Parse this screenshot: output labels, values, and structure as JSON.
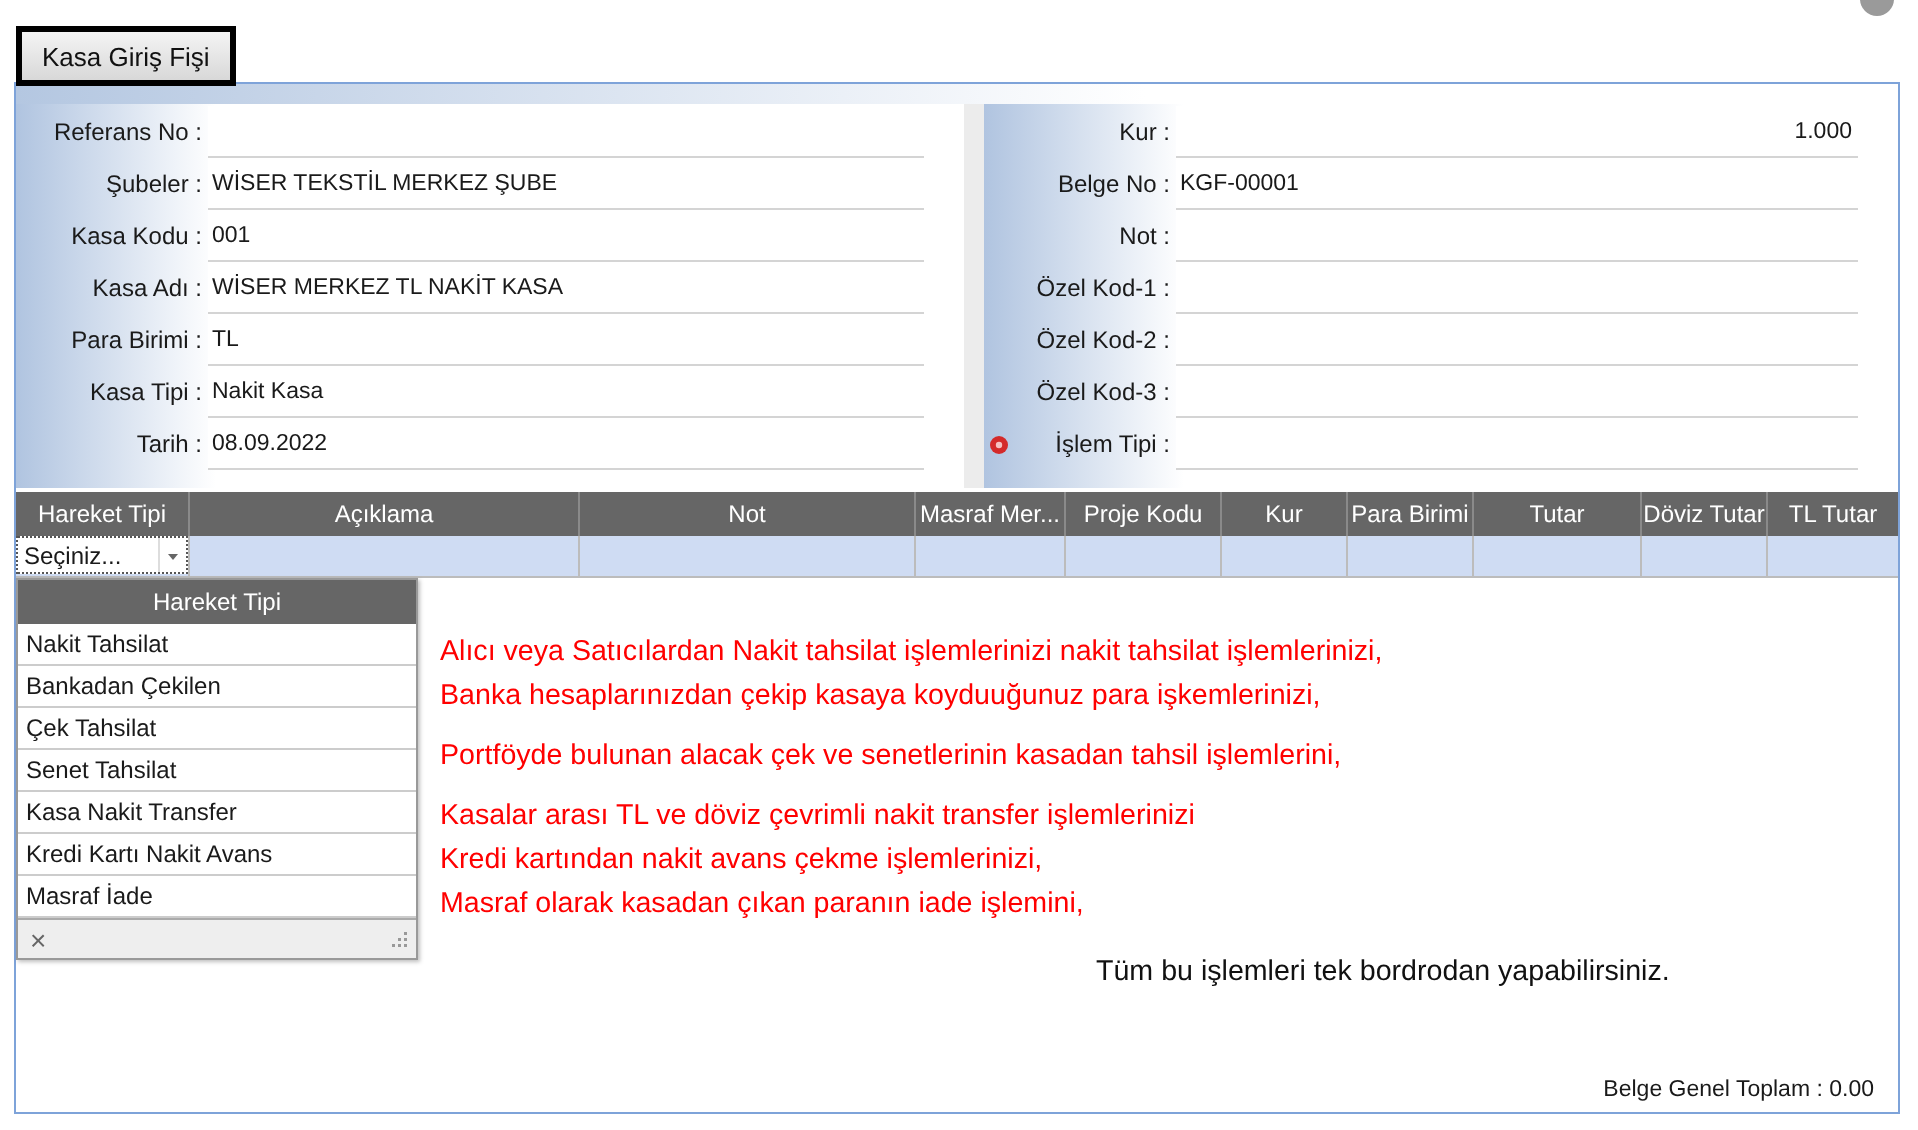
{
  "tab": {
    "label": "Kasa Giriş Fişi",
    "selected": true
  },
  "left_form": [
    {
      "label": "Referans No :",
      "required": false
    },
    {
      "label": "Şubeler :",
      "value": "WİSER TEKSTİL MERKEZ ŞUBE",
      "required": false
    },
    {
      "label": "Kasa Kodu :",
      "value": "001",
      "required": false
    },
    {
      "label": "Kasa Adı :",
      "value": "WİSER MERKEZ TL NAKİT KASA",
      "required": false
    },
    {
      "label": "Para Birimi :",
      "value": "TL",
      "required": false
    },
    {
      "label": "Kasa Tipi :",
      "value": "Nakit Kasa",
      "required": false
    },
    {
      "label": "Tarih :",
      "value": "08.09.2022",
      "required": false
    }
  ],
  "right_form": [
    {
      "label": "Kur :",
      "value": "1.000",
      "kind": "number",
      "required": false
    },
    {
      "label": "Belge No :",
      "value": "KGF-00001",
      "kind": "text",
      "required": false
    },
    {
      "label": "Not :",
      "required": false
    },
    {
      "label": "Özel Kod-1 :",
      "required": false
    },
    {
      "label": "Özel Kod-2 :",
      "required": false
    },
    {
      "label": "Özel Kod-3 :",
      "required": false
    },
    {
      "label": "İşlem Tipi :",
      "required": true
    }
  ],
  "grid": {
    "columns": [
      "Hareket Tipi",
      "Açıklama",
      "Not",
      "Masraf Mer...",
      "Proje Kodu",
      "Kur",
      "Para Birimi",
      "Tutar",
      "Döviz Tutar",
      "TL Tutar"
    ],
    "editor": {
      "value": "Seçiniz..."
    }
  },
  "dropdown": {
    "header": "Hareket Tipi",
    "items": [
      "Nakit Tahsilat",
      "Bankadan Çekilen",
      "Çek Tahsilat",
      "Senet Tahsilat",
      "Kasa Nakit Transfer",
      "Kredi Kartı Nakit Avans",
      "Masraf İade"
    ],
    "close": "×"
  },
  "notes": [
    {
      "lines": [
        "Alıcı veya Satıcılardan Nakit tahsilat işlemlerinizi nakit tahsilat işlemlerinizi,",
        "Banka hesaplarınızdan çekip kasaya koyduuğunuz para işkemlerinizi,"
      ]
    },
    {
      "lines": [
        "Portföyde bulunan alacak çek ve senetlerinin kasadan tahsil işlemlerini,"
      ]
    },
    {
      "lines": [
        "Kasalar arası TL ve döviz çevrimli nakit transfer işlemlerinizi",
        "Kredi kartından nakit avans çekme işlemlerinizi,",
        "Masraf olarak kasadan çıkan paranın iade işlemini,"
      ]
    }
  ],
  "closing": "Tüm bu işlemleri tek bordrodan yapabilirsiniz.",
  "total": "Belge Genel Toplam : 0.00"
}
